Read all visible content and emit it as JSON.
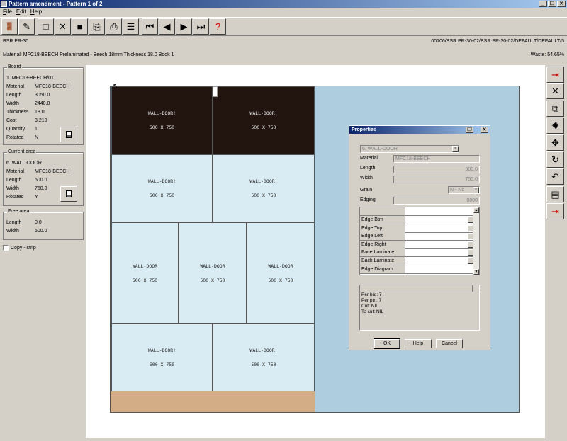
{
  "window": {
    "title": "Pattern amendment - Pattern 1 of 2"
  },
  "menu": [
    "File",
    "Edit",
    "Help"
  ],
  "toolbar": [
    {
      "name": "exit-icon",
      "glyph": "🚪"
    },
    {
      "name": "edit-icon",
      "glyph": "✎"
    },
    {
      "name": "new-icon",
      "glyph": "□"
    },
    {
      "name": "delete-icon",
      "glyph": "✕"
    },
    {
      "name": "select-all-icon",
      "glyph": "■"
    },
    {
      "name": "copy-icon",
      "glyph": "⎘"
    },
    {
      "name": "print-icon",
      "glyph": "⎙"
    },
    {
      "name": "list-icon",
      "glyph": "☰"
    },
    {
      "name": "first-icon",
      "glyph": "⏮"
    },
    {
      "name": "previous-icon",
      "glyph": "◀"
    },
    {
      "name": "next-icon",
      "glyph": "▶"
    },
    {
      "name": "last-icon",
      "glyph": "⏭"
    },
    {
      "name": "help-icon",
      "glyph": "?"
    }
  ],
  "header": {
    "batch": "BSR PR-30",
    "path": "00106/BSR PR-30-02/BSR PR-30-02/DEFAULT/DEFAULT/5",
    "material_line": "Material: MFC18-BEECH Prelaminated - Beech 18mm Thickness 18.0 Book 1",
    "waste": "Waste: 54.65%"
  },
  "board": {
    "title": "Board",
    "name": "1. MFC18-BEECH/01",
    "rows": [
      {
        "k": "Material",
        "v": "MFC18-BEECH"
      },
      {
        "k": "Length",
        "v": "3050.0"
      },
      {
        "k": "Width",
        "v": "2440.0"
      },
      {
        "k": "Thickness",
        "v": "18.0"
      },
      {
        "k": "Cost",
        "v": "3.210"
      },
      {
        "k": "Quantity",
        "v": "1"
      },
      {
        "k": "Rotated",
        "v": "N"
      }
    ]
  },
  "current": {
    "title": "Current area",
    "name": "6. WALL-DOOR",
    "rows": [
      {
        "k": "Material",
        "v": "MFC18-BEECH"
      },
      {
        "k": "Length",
        "v": "500.0"
      },
      {
        "k": "Width",
        "v": "750.0"
      },
      {
        "k": "Rotated",
        "v": "Y"
      }
    ]
  },
  "free": {
    "title": "Free area",
    "rows": [
      {
        "k": "Length",
        "v": "0.0"
      },
      {
        "k": "Width",
        "v": "500.0"
      }
    ]
  },
  "copy_strip": "Copy - strip",
  "parts": [
    {
      "label": "WALL-DOOR!",
      "dims": "500 X 750",
      "style": "dark"
    },
    {
      "label": "WALL-DOOR!",
      "dims": "500 X 750",
      "style": "dark"
    },
    {
      "label": "WALL-DOOR!",
      "dims": "500 X 750",
      "style": "light"
    },
    {
      "label": "WALL-DOOR!",
      "dims": "500 X 750",
      "style": "light"
    },
    {
      "label": "WALL-DOOR",
      "dims": "500 X 750",
      "style": "light"
    },
    {
      "label": "WALL-DOOR",
      "dims": "500 X 750",
      "style": "light"
    },
    {
      "label": "WALL-DOOR",
      "dims": "500 X 750",
      "style": "light"
    },
    {
      "label": "WALL-DOOR!",
      "dims": "500 X 750",
      "style": "light"
    },
    {
      "label": "WALL-DOOR!",
      "dims": "500 X 750",
      "style": "light"
    }
  ],
  "right_tools": [
    {
      "name": "insert-icon",
      "glyph": "⇥"
    },
    {
      "name": "close-icon",
      "glyph": "✕"
    },
    {
      "name": "duplicate-icon",
      "glyph": "⧉"
    },
    {
      "name": "saw-blade-icon",
      "glyph": "✹"
    },
    {
      "name": "move-icon",
      "glyph": "✥"
    },
    {
      "name": "rotate-icon",
      "glyph": "↻"
    },
    {
      "name": "undo-icon",
      "glyph": "↶"
    },
    {
      "name": "document-icon",
      "glyph": "▤"
    },
    {
      "name": "export-icon",
      "glyph": "⇥"
    }
  ],
  "properties": {
    "title": "Properties",
    "part": "6. WALL-DOOR",
    "material_label": "Material",
    "material": "MFC18-BEECH",
    "length_label": "Length",
    "length": "500.0",
    "width_label": "Width",
    "width": "750.0",
    "grain_label": "Grain",
    "grain": "N - No",
    "edging_label": "Edging",
    "edging": "0000",
    "grid_rows": [
      "Edge Btm",
      "Edge Top",
      "Edge Left",
      "Edge Right",
      "Face Laminate",
      "Back Laminate",
      "Edge Diagram"
    ],
    "stats": [
      "Per brd: 7",
      "Per ptn: 7",
      "Cut: NIL",
      "To cut: NIL"
    ],
    "ok": "OK",
    "help": "Help",
    "cancel": "Cancel"
  }
}
